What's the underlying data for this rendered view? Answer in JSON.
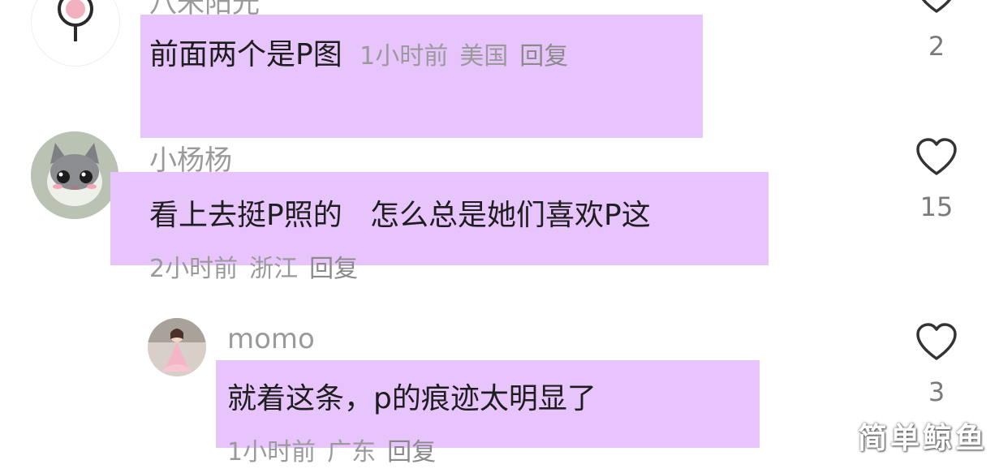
{
  "comments": [
    {
      "username": "八米阳光",
      "text": "前面两个是P图",
      "time": "1小时前",
      "location": "美国",
      "reply": "回复",
      "likes": "2",
      "highlight_color": "#e8c4fd"
    },
    {
      "username": "小杨杨",
      "text": "看上去挺P照的   怎么总是她们喜欢P这",
      "time": "2小时前",
      "location": "浙江",
      "reply": "回复",
      "likes": "15"
    },
    {
      "username": "momo",
      "text": "就着这条，p的痕迹太明显了",
      "time": "1小时前",
      "location": "广东",
      "reply": "回复",
      "likes": "3"
    }
  ],
  "icons": {
    "like": "heart-outline-icon"
  },
  "watermark": "简单鲸鱼"
}
